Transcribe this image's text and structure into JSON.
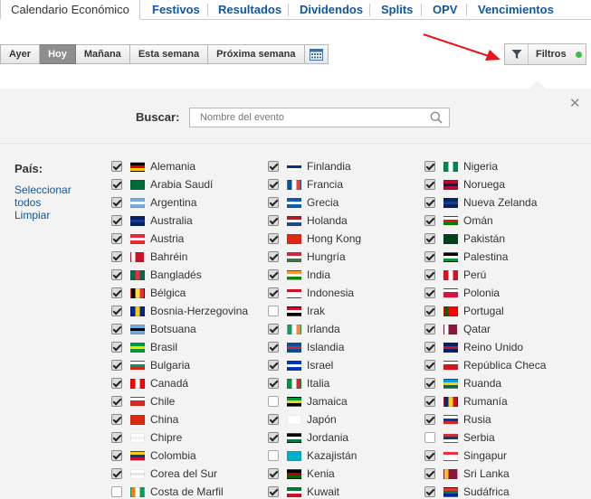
{
  "topnav": {
    "tabs": [
      "Calendario Económico",
      "Festivos",
      "Resultados",
      "Dividendos",
      "Splits",
      "OPV",
      "Vencimientos"
    ]
  },
  "daybar": {
    "buttons": [
      "Ayer",
      "Hoy",
      "Mañana",
      "Esta semana",
      "Próxima semana"
    ],
    "active": "Hoy",
    "calendar_icon": "calendar-icon"
  },
  "filters": {
    "label": "Filtros",
    "icon": "funnel-icon",
    "status_color": "#3fbf3f"
  },
  "search": {
    "label": "Buscar:",
    "placeholder": "Nombre del evento",
    "icon": "search-icon"
  },
  "countries": {
    "label": "País:",
    "select_all": "Seleccionar todos",
    "clear": "Limpiar",
    "columns": [
      [
        {
          "name": "Alemania",
          "checked": true,
          "flag": [
            "#000000",
            "#dd0000",
            "#ffce00"
          ],
          "dir": "h"
        },
        {
          "name": "Arabia Saudí",
          "checked": true,
          "flag": [
            "#006c35",
            "#006c35",
            "#006c35"
          ],
          "dir": "h"
        },
        {
          "name": "Argentina",
          "checked": true,
          "flag": [
            "#74acdf",
            "#ffffff",
            "#74acdf"
          ],
          "dir": "h"
        },
        {
          "name": "Australia",
          "checked": true,
          "flag": [
            "#012169",
            "#1a3a8a",
            "#012169"
          ],
          "dir": "h"
        },
        {
          "name": "Austria",
          "checked": true,
          "flag": [
            "#ed2939",
            "#ffffff",
            "#ed2939"
          ],
          "dir": "h"
        },
        {
          "name": "Bahréin",
          "checked": true,
          "flag": [
            "#ffffff",
            "#ce1126",
            "#ce1126"
          ],
          "dir": "v"
        },
        {
          "name": "Bangladés",
          "checked": true,
          "flag": [
            "#006a4e",
            "#f42a41",
            "#006a4e"
          ],
          "dir": "v"
        },
        {
          "name": "Bélgica",
          "checked": true,
          "flag": [
            "#000000",
            "#fae042",
            "#ed2939"
          ],
          "dir": "v"
        },
        {
          "name": "Bosnia-Herzegovina",
          "checked": true,
          "flag": [
            "#002395",
            "#fecb00",
            "#002395"
          ],
          "dir": "v"
        },
        {
          "name": "Botsuana",
          "checked": true,
          "flag": [
            "#75aadb",
            "#000000",
            "#75aadb"
          ],
          "dir": "h"
        },
        {
          "name": "Brasil",
          "checked": true,
          "flag": [
            "#009c3b",
            "#ffdf00",
            "#009c3b"
          ],
          "dir": "h"
        },
        {
          "name": "Bulgaria",
          "checked": true,
          "flag": [
            "#ffffff",
            "#00966e",
            "#d62612"
          ],
          "dir": "h"
        },
        {
          "name": "Canadá",
          "checked": true,
          "flag": [
            "#ff0000",
            "#ffffff",
            "#ff0000"
          ],
          "dir": "v"
        },
        {
          "name": "Chile",
          "checked": true,
          "flag": [
            "#ffffff",
            "#d52b1e",
            "#d52b1e"
          ],
          "dir": "h"
        },
        {
          "name": "China",
          "checked": true,
          "flag": [
            "#de2910",
            "#de2910",
            "#de2910"
          ],
          "dir": "h"
        },
        {
          "name": "Chipre",
          "checked": true,
          "flag": [
            "#ffffff",
            "#f0f0f0",
            "#ffffff"
          ],
          "dir": "h"
        },
        {
          "name": "Colombia",
          "checked": true,
          "flag": [
            "#fcd116",
            "#003893",
            "#ce1126"
          ],
          "dir": "h"
        },
        {
          "name": "Corea del Sur",
          "checked": true,
          "flag": [
            "#ffffff",
            "#e8e8e8",
            "#ffffff"
          ],
          "dir": "h"
        },
        {
          "name": "Costa de Marfil",
          "checked": false,
          "flag": [
            "#f77f00",
            "#ffffff",
            "#009e60"
          ],
          "dir": "v"
        }
      ],
      [
        {
          "name": "Finlandia",
          "checked": true,
          "flag": [
            "#ffffff",
            "#003580",
            "#ffffff"
          ],
          "dir": "h"
        },
        {
          "name": "Francia",
          "checked": true,
          "flag": [
            "#0055a4",
            "#ffffff",
            "#ef4135"
          ],
          "dir": "v"
        },
        {
          "name": "Grecia",
          "checked": true,
          "flag": [
            "#0d5eaf",
            "#ffffff",
            "#0d5eaf"
          ],
          "dir": "h"
        },
        {
          "name": "Holanda",
          "checked": true,
          "flag": [
            "#ae1c28",
            "#ffffff",
            "#21468b"
          ],
          "dir": "h"
        },
        {
          "name": "Hong Kong",
          "checked": true,
          "flag": [
            "#de2910",
            "#de2910",
            "#de2910"
          ],
          "dir": "h"
        },
        {
          "name": "Hungría",
          "checked": true,
          "flag": [
            "#ce2939",
            "#ffffff",
            "#477050"
          ],
          "dir": "h"
        },
        {
          "name": "India",
          "checked": true,
          "flag": [
            "#ff9933",
            "#ffffff",
            "#138808"
          ],
          "dir": "h"
        },
        {
          "name": "Indonesia",
          "checked": true,
          "flag": [
            "#ce1126",
            "#ffffff",
            "#ffffff"
          ],
          "dir": "h"
        },
        {
          "name": "Irak",
          "checked": false,
          "flag": [
            "#ce1126",
            "#ffffff",
            "#000000"
          ],
          "dir": "h"
        },
        {
          "name": "Irlanda",
          "checked": true,
          "flag": [
            "#169b62",
            "#ffffff",
            "#ff883e"
          ],
          "dir": "v"
        },
        {
          "name": "Islandia",
          "checked": true,
          "flag": [
            "#02529c",
            "#dc1e35",
            "#02529c"
          ],
          "dir": "h"
        },
        {
          "name": "Israel",
          "checked": true,
          "flag": [
            "#0038b8",
            "#ffffff",
            "#0038b8"
          ],
          "dir": "h"
        },
        {
          "name": "Italia",
          "checked": true,
          "flag": [
            "#009246",
            "#ffffff",
            "#ce2b37"
          ],
          "dir": "v"
        },
        {
          "name": "Jamaica",
          "checked": false,
          "flag": [
            "#009b3a",
            "#fed100",
            "#000000"
          ],
          "dir": "h"
        },
        {
          "name": "Japón",
          "checked": true,
          "flag": [
            "#ffffff",
            "#ffffff",
            "#ffffff"
          ],
          "dir": "h"
        },
        {
          "name": "Jordania",
          "checked": true,
          "flag": [
            "#000000",
            "#ffffff",
            "#007a3d"
          ],
          "dir": "h"
        },
        {
          "name": "Kazajistán",
          "checked": false,
          "flag": [
            "#00afca",
            "#00afca",
            "#00afca"
          ],
          "dir": "h"
        },
        {
          "name": "Kenia",
          "checked": true,
          "flag": [
            "#000000",
            "#bb0000",
            "#006600"
          ],
          "dir": "h"
        },
        {
          "name": "Kuwait",
          "checked": true,
          "flag": [
            "#007a3d",
            "#ffffff",
            "#ce1126"
          ],
          "dir": "h"
        }
      ],
      [
        {
          "name": "Nigeria",
          "checked": true,
          "flag": [
            "#008751",
            "#ffffff",
            "#008751"
          ],
          "dir": "v"
        },
        {
          "name": "Noruega",
          "checked": true,
          "flag": [
            "#ba0c2f",
            "#00205b",
            "#ba0c2f"
          ],
          "dir": "h"
        },
        {
          "name": "Nueva Zelanda",
          "checked": true,
          "flag": [
            "#012169",
            "#1a3a8a",
            "#012169"
          ],
          "dir": "h"
        },
        {
          "name": "Omán",
          "checked": true,
          "flag": [
            "#ffffff",
            "#db161b",
            "#008000"
          ],
          "dir": "h"
        },
        {
          "name": "Pakistán",
          "checked": true,
          "flag": [
            "#01411c",
            "#01411c",
            "#01411c"
          ],
          "dir": "h"
        },
        {
          "name": "Palestina",
          "checked": true,
          "flag": [
            "#000000",
            "#ffffff",
            "#009736"
          ],
          "dir": "h"
        },
        {
          "name": "Perú",
          "checked": true,
          "flag": [
            "#d91023",
            "#ffffff",
            "#d91023"
          ],
          "dir": "v"
        },
        {
          "name": "Polonia",
          "checked": true,
          "flag": [
            "#ffffff",
            "#dc143c",
            "#dc143c"
          ],
          "dir": "h"
        },
        {
          "name": "Portugal",
          "checked": true,
          "flag": [
            "#006600",
            "#ff0000",
            "#ff0000"
          ],
          "dir": "v"
        },
        {
          "name": "Qatar",
          "checked": true,
          "flag": [
            "#ffffff",
            "#8a1538",
            "#8a1538"
          ],
          "dir": "v"
        },
        {
          "name": "Reino Unido",
          "checked": true,
          "flag": [
            "#012169",
            "#c8102e",
            "#012169"
          ],
          "dir": "h"
        },
        {
          "name": "República Checa",
          "checked": true,
          "flag": [
            "#ffffff",
            "#d7141a",
            "#d7141a"
          ],
          "dir": "h"
        },
        {
          "name": "Ruanda",
          "checked": true,
          "flag": [
            "#00a1de",
            "#fad201",
            "#20603d"
          ],
          "dir": "h"
        },
        {
          "name": "Rumanía",
          "checked": true,
          "flag": [
            "#002b7f",
            "#fcd116",
            "#ce1126"
          ],
          "dir": "v"
        },
        {
          "name": "Rusia",
          "checked": true,
          "flag": [
            "#ffffff",
            "#0039a6",
            "#d52b1e"
          ],
          "dir": "h"
        },
        {
          "name": "Serbia",
          "checked": false,
          "flag": [
            "#c6363c",
            "#0c4076",
            "#ffffff"
          ],
          "dir": "h"
        },
        {
          "name": "Singapur",
          "checked": true,
          "flag": [
            "#ef3340",
            "#ffffff",
            "#ffffff"
          ],
          "dir": "h"
        },
        {
          "name": "Sri Lanka",
          "checked": true,
          "flag": [
            "#ffbe29",
            "#8d153a",
            "#8d153a"
          ],
          "dir": "v"
        },
        {
          "name": "Sudáfrica",
          "checked": true,
          "flag": [
            "#de3831",
            "#007a4d",
            "#002395"
          ],
          "dir": "h"
        }
      ]
    ]
  }
}
